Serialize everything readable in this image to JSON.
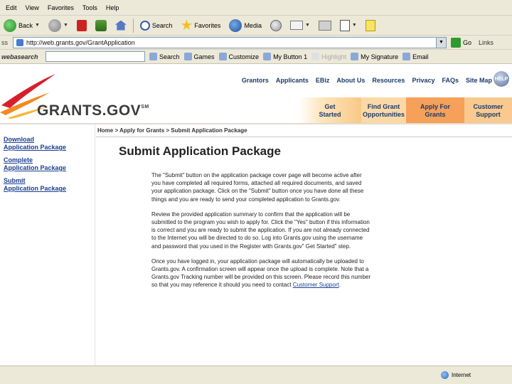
{
  "menu": [
    "Edit",
    "View",
    "Favorites",
    "Tools",
    "Help"
  ],
  "toolbar": {
    "back": "Back",
    "search": "Search",
    "favorites": "Favorites",
    "media": "Media"
  },
  "address": {
    "label": "ss",
    "url": "http://web.grants.gov/GrantApplication",
    "go": "Go",
    "links": "Links"
  },
  "searchbar": {
    "brand": "webasearch",
    "search": "Search",
    "games": "Games",
    "customize": "Customize",
    "my_button": "My Button 1",
    "highlight": "Highlight",
    "my_signature": "My Signature",
    "email": "Email"
  },
  "site": {
    "brand": "GRANTS.GOV",
    "brand_mark": "SM",
    "top_nav": [
      "Grantors",
      "Applicants",
      "EBiz",
      "About Us",
      "Resources",
      "Privacy",
      "FAQs",
      "Site Map"
    ],
    "help": "HELP",
    "tabs": [
      {
        "line1": "Get",
        "line2": "Started"
      },
      {
        "line1": "Find Grant",
        "line2": "Opportunities"
      },
      {
        "line1": "Apply For",
        "line2": "Grants"
      },
      {
        "line1": "Customer",
        "line2": "Support"
      }
    ]
  },
  "leftnav": [
    {
      "line1": "Download",
      "line2": "Application Package"
    },
    {
      "line1": "Complete",
      "line2": "Application Package"
    },
    {
      "line1": "Submit",
      "line2": "Application Package"
    }
  ],
  "main": {
    "breadcrumb": "Home > Apply for Grants > Submit Application Package",
    "title": "Submit Application Package",
    "para1": "The \"Submit\" button on the application package cover page will become active after you have completed all required forms, attached all required documents, and saved your application package. Click on the \"Submit\" button once you have done all these things and you are ready to send your completed application to Grants.gov.",
    "para2": "Review the provided application summary to confirm that the application will be submitted to the program you wish to apply for. Click the \"Yes\" button if this information is correct and you are ready to submit the application. If you are not already connected to the Internet you will be directed to do so. Log into Grants.gov using the username and password that you used in the Register with Grants.gov\" Get Started\" step.",
    "para3_before": "Once you have logged in, your application package will automatically be uploaded to Grants.gov. A confirmation screen will appear once the upload is complete. Note that a Grants.gov Tracking number will be provided on this screen. Please record this number so that you may reference it should you need to contact ",
    "para3_link": "Customer Support",
    "para3_after": "."
  },
  "status": {
    "zone": "Internet"
  }
}
